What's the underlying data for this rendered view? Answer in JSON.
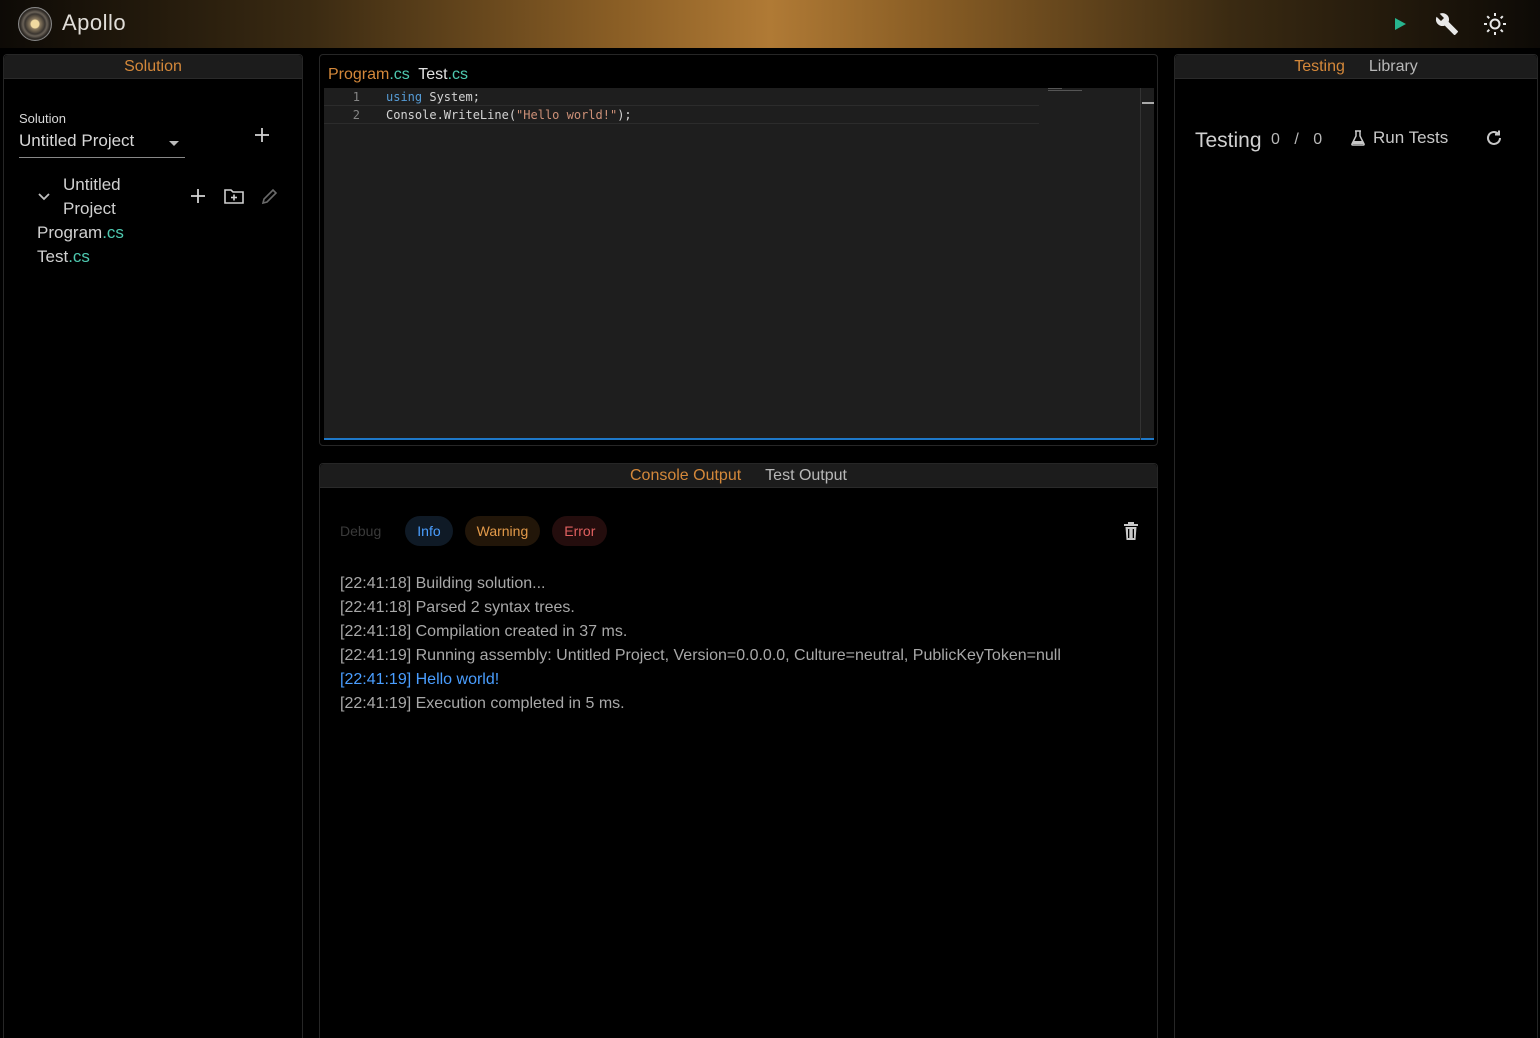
{
  "app": {
    "title": "Apollo"
  },
  "header": {
    "run_icon": "play-icon",
    "build_icon": "wrench-icon",
    "theme_icon": "sun-icon",
    "accent_color": "#d4883a",
    "run_color": "#27b58f"
  },
  "left_panel": {
    "tab": "Solution",
    "solution_label": "Solution",
    "solution_value": "Untitled Project",
    "project_name_line1": "Untitled",
    "project_name_line2": "Project",
    "files": [
      {
        "name": "Program",
        "ext": ".cs"
      },
      {
        "name": "Test",
        "ext": ".cs"
      }
    ]
  },
  "editor": {
    "tabs": [
      {
        "name": "Program",
        "ext": ".cs",
        "active": true
      },
      {
        "name": "Test",
        "ext": ".cs",
        "active": false
      }
    ],
    "lines": [
      {
        "num": "1",
        "kw": "using",
        "rest": " System;"
      },
      {
        "num": "2",
        "pre": "Console.WriteLine(",
        "str": "\"Hello world!\"",
        "post": ");"
      }
    ]
  },
  "console": {
    "tabs": [
      "Console Output",
      "Test Output"
    ],
    "filters": {
      "debug": "Debug",
      "info": "Info",
      "warning": "Warning",
      "error": "Error"
    },
    "log": [
      {
        "text": "[22:41:18] Building solution...",
        "level": "info-plain"
      },
      {
        "text": "[22:41:18] Parsed 2 syntax trees.",
        "level": "info-plain"
      },
      {
        "text": "[22:41:18] Compilation created in 37 ms.",
        "level": "info-plain"
      },
      {
        "text": "[22:41:19] Running assembly: Untitled Project, Version=0.0.0.0, Culture=neutral, PublicKeyToken=null",
        "level": "info-plain"
      },
      {
        "text": "[22:41:19] Hello world!",
        "level": "highlight"
      },
      {
        "text": "[22:41:19] Execution completed in 5 ms.",
        "level": "info-plain"
      }
    ]
  },
  "right_panel": {
    "tabs": [
      "Testing",
      "Library"
    ],
    "title": "Testing",
    "passed": "0",
    "separator": "/",
    "total": "0",
    "run_tests_label": "Run Tests"
  }
}
